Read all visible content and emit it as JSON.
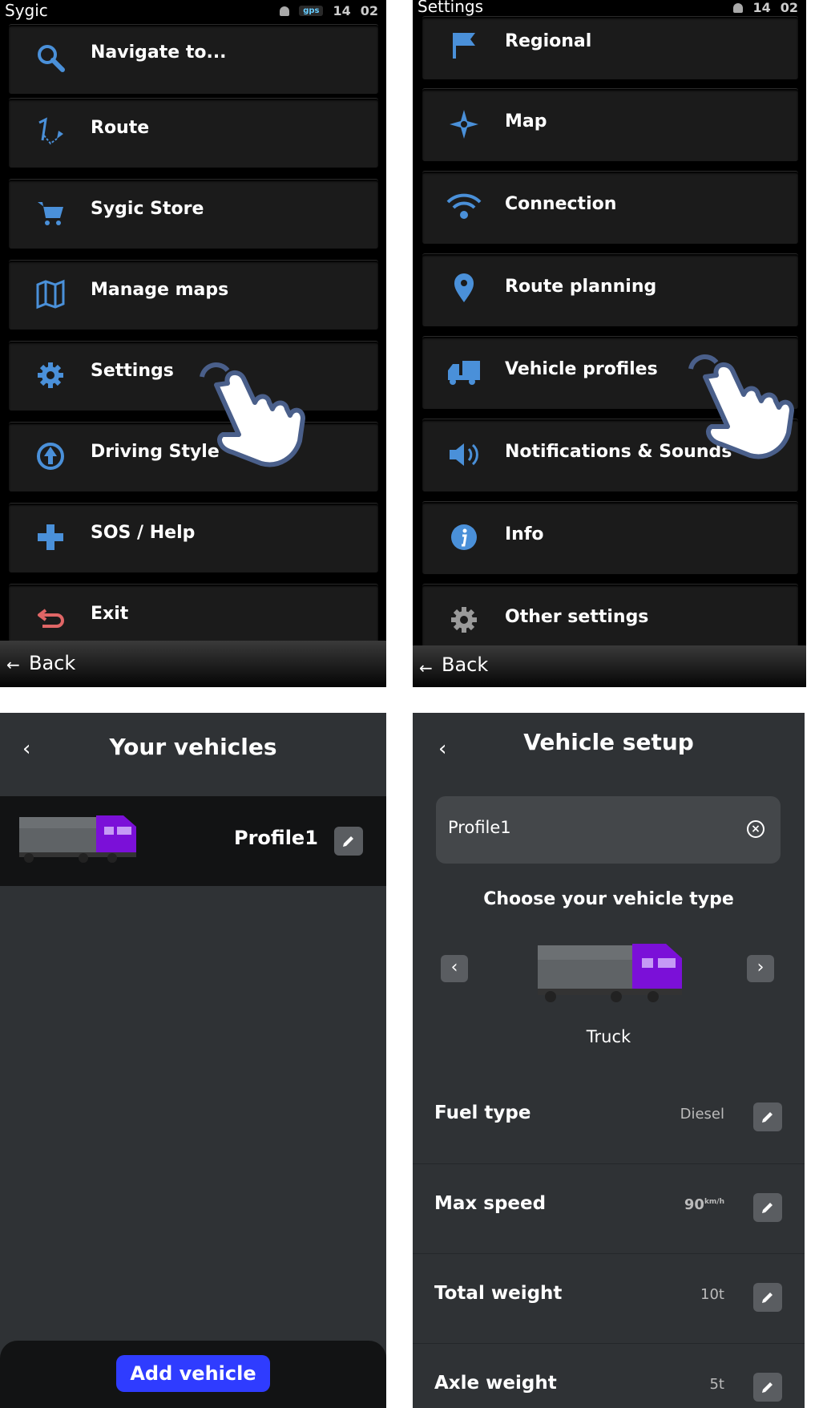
{
  "panel1": {
    "status": {
      "app_title": "Sygic",
      "gps": "gps",
      "time_h": "14",
      "time_m": "02"
    },
    "menu": [
      {
        "label": "Navigate to...",
        "icon": "search-icon"
      },
      {
        "label": "Route",
        "icon": "route-icon"
      },
      {
        "label": "Sygic Store",
        "icon": "cart-icon"
      },
      {
        "label": "Manage maps",
        "icon": "map-icon"
      },
      {
        "label": "Settings",
        "icon": "gear-icon"
      },
      {
        "label": "Driving Style",
        "icon": "driving-style-icon"
      },
      {
        "label": "SOS / Help",
        "icon": "plus-icon"
      },
      {
        "label": "Exit",
        "icon": "exit-icon"
      }
    ],
    "back_label": "Back"
  },
  "panel2": {
    "status": {
      "app_title": "Settings",
      "time_h": "14",
      "time_m": "02"
    },
    "menu": [
      {
        "label": "Regional",
        "icon": "flag-icon"
      },
      {
        "label": "Map",
        "icon": "compass-icon"
      },
      {
        "label": "Connection",
        "icon": "wifi-icon"
      },
      {
        "label": "Route planning",
        "icon": "pin-icon"
      },
      {
        "label": "Vehicle profiles",
        "icon": "vehicle-icon"
      },
      {
        "label": "Notifications & Sounds",
        "icon": "speaker-icon"
      },
      {
        "label": "Info",
        "icon": "info-icon"
      },
      {
        "label": "Other settings",
        "icon": "gear-icon"
      }
    ],
    "back_label": "Back"
  },
  "panel3": {
    "title": "Your vehicles",
    "profile_name": "Profile1",
    "add_button": "Add vehicle"
  },
  "panel4": {
    "title": "Vehicle setup",
    "profile_field": "Profile1",
    "choose_label": "Choose your vehicle type",
    "vehicle_type": "Truck",
    "settings": [
      {
        "name": "Fuel type",
        "value": "Diesel"
      },
      {
        "name": "Max speed",
        "value": "90",
        "unit": "km/h"
      },
      {
        "name": "Total weight",
        "value": "10t"
      },
      {
        "name": "Axle weight",
        "value": "5t"
      }
    ]
  },
  "colors": {
    "icon_blue": "#4a90d9",
    "exit_red": "#e06666",
    "truck_purple": "#7b10d8",
    "add_button": "#2f3cff"
  }
}
